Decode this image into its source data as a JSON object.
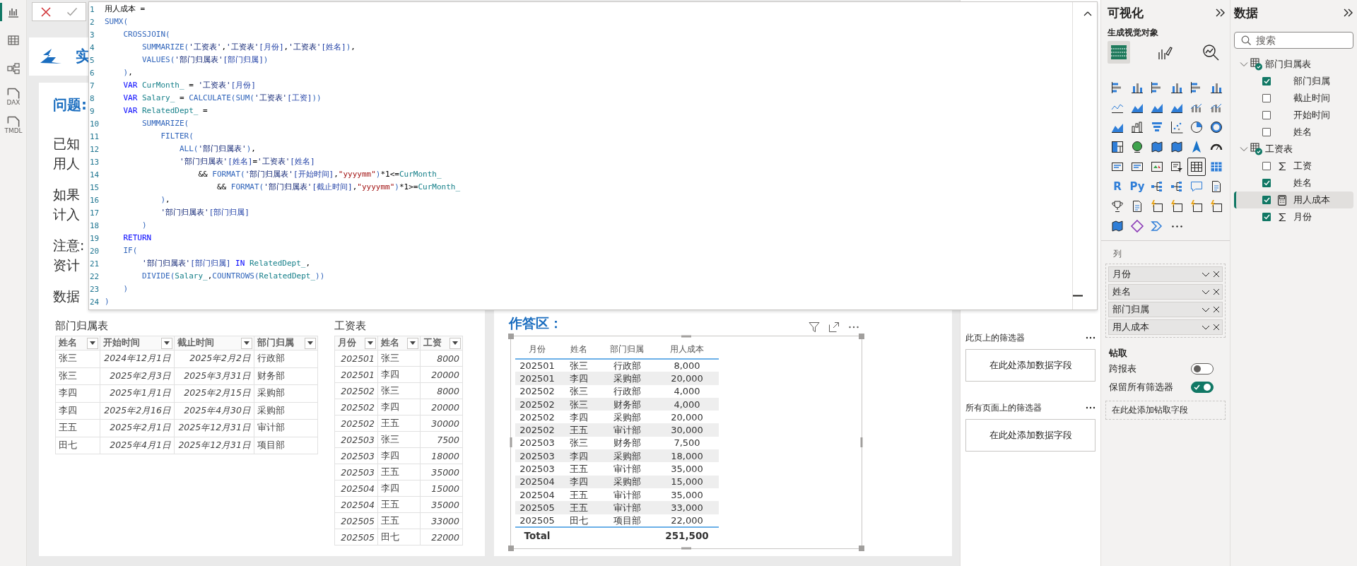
{
  "nav": [
    {
      "kind": "report",
      "selected": true
    },
    {
      "kind": "table",
      "selected": false
    },
    {
      "kind": "model",
      "selected": false
    },
    {
      "kind": "doc",
      "label": "DAX",
      "selected": false
    },
    {
      "kind": "doc",
      "label": "TMDL",
      "selected": false
    }
  ],
  "editor": {
    "lines": [
      {
        "number": "1",
        "tokens": [
          {
            "kind": "plain",
            "text": "用人成本 ="
          }
        ]
      },
      {
        "number": "2",
        "tokens": [
          {
            "kind": "fn",
            "text": "SUMX("
          }
        ]
      },
      {
        "number": "3",
        "tokens": [
          {
            "kind": "fn",
            "text": "    CROSSJOIN("
          }
        ]
      },
      {
        "number": "4",
        "tokens": [
          {
            "kind": "fn",
            "text": "        SUMMARIZE("
          },
          {
            "kind": "tbl",
            "text": "'工资表'"
          },
          {
            "kind": "plain",
            "text": ","
          },
          {
            "kind": "tbl",
            "text": "'工资表'"
          },
          {
            "kind": "col",
            "text": "[月份]"
          },
          {
            "kind": "plain",
            "text": ","
          },
          {
            "kind": "tbl",
            "text": "'工资表'"
          },
          {
            "kind": "col",
            "text": "[姓名]"
          },
          {
            "kind": "fn",
            "text": ")"
          },
          {
            "kind": "plain",
            "text": ","
          }
        ]
      },
      {
        "number": "5",
        "tokens": [
          {
            "kind": "fn",
            "text": "        VALUES("
          },
          {
            "kind": "tbl",
            "text": "'部门归属表'"
          },
          {
            "kind": "col",
            "text": "[部门归属]"
          },
          {
            "kind": "fn",
            "text": ")"
          }
        ]
      },
      {
        "number": "6",
        "tokens": [
          {
            "kind": "fn",
            "text": "    )"
          },
          {
            "kind": "plain",
            "text": ","
          }
        ]
      },
      {
        "number": "7",
        "tokens": [
          {
            "kind": "kw",
            "text": "    VAR"
          },
          {
            "kind": "var",
            "text": " CurMonth_"
          },
          {
            "kind": "plain",
            "text": " = "
          },
          {
            "kind": "tbl",
            "text": "'工资表'"
          },
          {
            "kind": "col",
            "text": "[月份]"
          }
        ]
      },
      {
        "number": "8",
        "tokens": [
          {
            "kind": "kw",
            "text": "    VAR"
          },
          {
            "kind": "var",
            "text": " Salary_"
          },
          {
            "kind": "plain",
            "text": " = "
          },
          {
            "kind": "fn",
            "text": "CALCULATE(SUM("
          },
          {
            "kind": "tbl",
            "text": "'工资表'"
          },
          {
            "kind": "col",
            "text": "[工资]"
          },
          {
            "kind": "fn",
            "text": "))"
          }
        ]
      },
      {
        "number": "9",
        "tokens": [
          {
            "kind": "kw",
            "text": "    VAR"
          },
          {
            "kind": "var",
            "text": " RelatedDept_"
          },
          {
            "kind": "plain",
            "text": " ="
          }
        ]
      },
      {
        "number": "10",
        "tokens": [
          {
            "kind": "fn",
            "text": "        SUMMARIZE("
          }
        ]
      },
      {
        "number": "11",
        "tokens": [
          {
            "kind": "fn",
            "text": "            FILTER("
          }
        ]
      },
      {
        "number": "12",
        "tokens": [
          {
            "kind": "fn",
            "text": "                ALL("
          },
          {
            "kind": "tbl",
            "text": "'部门归属表'"
          },
          {
            "kind": "fn",
            "text": ")"
          },
          {
            "kind": "plain",
            "text": ","
          }
        ]
      },
      {
        "number": "13",
        "tokens": [
          {
            "kind": "tbl",
            "text": "                '部门归属表'"
          },
          {
            "kind": "col",
            "text": "[姓名]"
          },
          {
            "kind": "plain",
            "text": "="
          },
          {
            "kind": "tbl",
            "text": "'工资表'"
          },
          {
            "kind": "col",
            "text": "[姓名]"
          }
        ]
      },
      {
        "number": "14",
        "tokens": [
          {
            "kind": "plain",
            "text": "                    && "
          },
          {
            "kind": "fn",
            "text": "FORMAT("
          },
          {
            "kind": "tbl",
            "text": "'部门归属表'"
          },
          {
            "kind": "col",
            "text": "[开始时间]"
          },
          {
            "kind": "plain",
            "text": ","
          },
          {
            "kind": "str",
            "text": "\"yyyymm\""
          },
          {
            "kind": "fn",
            "text": ")"
          },
          {
            "kind": "plain",
            "text": "*1<="
          },
          {
            "kind": "var",
            "text": "CurMonth_"
          }
        ]
      },
      {
        "number": "15",
        "tokens": [
          {
            "kind": "plain",
            "text": "                        && "
          },
          {
            "kind": "fn",
            "text": "FORMAT("
          },
          {
            "kind": "tbl",
            "text": "'部门归属表'"
          },
          {
            "kind": "col",
            "text": "[截止时间]"
          },
          {
            "kind": "plain",
            "text": ","
          },
          {
            "kind": "str",
            "text": "\"yyyymm\""
          },
          {
            "kind": "fn",
            "text": ")"
          },
          {
            "kind": "plain",
            "text": "*1>="
          },
          {
            "kind": "var",
            "text": "CurMonth_"
          }
        ]
      },
      {
        "number": "16",
        "tokens": [
          {
            "kind": "fn",
            "text": "            )"
          },
          {
            "kind": "plain",
            "text": ","
          }
        ]
      },
      {
        "number": "17",
        "tokens": [
          {
            "kind": "tbl",
            "text": "            '部门归属表'"
          },
          {
            "kind": "col",
            "text": "[部门归属]"
          }
        ]
      },
      {
        "number": "18",
        "tokens": [
          {
            "kind": "fn",
            "text": "        )"
          }
        ]
      },
      {
        "number": "19",
        "tokens": [
          {
            "kind": "kw",
            "text": "    RETURN"
          }
        ]
      },
      {
        "number": "20",
        "tokens": [
          {
            "kind": "fn",
            "text": "    IF("
          }
        ]
      },
      {
        "number": "21",
        "tokens": [
          {
            "kind": "tbl",
            "text": "        '部门归属表'"
          },
          {
            "kind": "col",
            "text": "[部门归属]"
          },
          {
            "kind": "kw",
            "text": " IN"
          },
          {
            "kind": "var",
            "text": " RelatedDept_"
          },
          {
            "kind": "plain",
            "text": ","
          }
        ]
      },
      {
        "number": "22",
        "tokens": [
          {
            "kind": "fn",
            "text": "        DIVIDE("
          },
          {
            "kind": "var",
            "text": "Salary_"
          },
          {
            "kind": "plain",
            "text": ","
          },
          {
            "kind": "fn",
            "text": "COUNTROWS("
          },
          {
            "kind": "var",
            "text": "RelatedDept_"
          },
          {
            "kind": "fn",
            "text": "))"
          }
        ]
      },
      {
        "number": "23",
        "tokens": [
          {
            "kind": "fn",
            "text": "    )"
          }
        ]
      },
      {
        "number": "24",
        "tokens": [
          {
            "kind": "fn",
            "text": ")"
          }
        ]
      }
    ]
  },
  "canvas": {
    "header_text": "实",
    "question_title": "问题:",
    "paragraphs": [
      [
        "已知",
        "用人"
      ],
      [
        "如果",
        "计入"
      ],
      [
        "注意:",
        "资计"
      ],
      [
        "数据"
      ]
    ],
    "tables": [
      {
        "title": "部门归属表",
        "columns": [
          {
            "name": "姓名",
            "kind": "text"
          },
          {
            "name": "开始时间",
            "kind": "date"
          },
          {
            "name": "截止时间",
            "kind": "date"
          },
          {
            "name": "部门归属",
            "kind": "text"
          }
        ],
        "rows": [
          [
            "张三",
            "2024年12月1日",
            "2025年2月2日",
            "行政部"
          ],
          [
            "张三",
            "2025年2月3日",
            "2025年3月31日",
            "财务部"
          ],
          [
            "李四",
            "2025年1月1日",
            "2025年2月15日",
            "采购部"
          ],
          [
            "李四",
            "2025年2月16日",
            "2025年4月30日",
            "采购部"
          ],
          [
            "王五",
            "2025年2月1日",
            "2025年12月31日",
            "审计部"
          ],
          [
            "田七",
            "2025年4月1日",
            "2025年12月31日",
            "项目部"
          ]
        ]
      },
      {
        "title": "工资表",
        "columns": [
          {
            "name": "月份",
            "kind": "number"
          },
          {
            "name": "姓名",
            "kind": "text"
          },
          {
            "name": "工资",
            "kind": "number"
          }
        ],
        "rows": [
          [
            "202501",
            "张三",
            "8000"
          ],
          [
            "202501",
            "李四",
            "20000"
          ],
          [
            "202502",
            "张三",
            "8000"
          ],
          [
            "202502",
            "李四",
            "20000"
          ],
          [
            "202502",
            "王五",
            "30000"
          ],
          [
            "202503",
            "张三",
            "7500"
          ],
          [
            "202503",
            "李四",
            "18000"
          ],
          [
            "202503",
            "王五",
            "35000"
          ],
          [
            "202504",
            "李四",
            "15000"
          ],
          [
            "202504",
            "王五",
            "35000"
          ],
          [
            "202505",
            "王五",
            "33000"
          ],
          [
            "202505",
            "田七",
            "22000"
          ]
        ]
      }
    ],
    "answer": {
      "title": "作答区：",
      "columns": [
        "月份",
        "姓名",
        "部门归属",
        "用人成本"
      ],
      "rows": [
        [
          "202501",
          "张三",
          "行政部",
          "8,000"
        ],
        [
          "202501",
          "李四",
          "采购部",
          "20,000"
        ],
        [
          "202502",
          "张三",
          "行政部",
          "4,000"
        ],
        [
          "202502",
          "张三",
          "财务部",
          "4,000"
        ],
        [
          "202502",
          "李四",
          "采购部",
          "20,000"
        ],
        [
          "202502",
          "王五",
          "审计部",
          "30,000"
        ],
        [
          "202503",
          "张三",
          "财务部",
          "7,500"
        ],
        [
          "202503",
          "李四",
          "采购部",
          "18,000"
        ],
        [
          "202503",
          "王五",
          "审计部",
          "35,000"
        ],
        [
          "202504",
          "李四",
          "采购部",
          "15,000"
        ],
        [
          "202504",
          "王五",
          "审计部",
          "35,000"
        ],
        [
          "202505",
          "王五",
          "审计部",
          "33,000"
        ],
        [
          "202505",
          "田七",
          "项目部",
          "22,000"
        ]
      ],
      "total": {
        "label": "Total",
        "value": "251,500"
      }
    }
  },
  "filters": {
    "sections": [
      {
        "title": "此页上的筛选器",
        "drop_text": "在此处添加数据字段"
      },
      {
        "title": "所有页面上的筛选器",
        "drop_text": "在此处添加数据字段"
      }
    ]
  },
  "visualizations": {
    "title": "可视化",
    "subtitle": "生成视觉对象",
    "build_tabs": [
      {
        "kind": "fields",
        "selected": true
      },
      {
        "kind": "format",
        "selected": false
      },
      {
        "kind": "analytics",
        "selected": false
      }
    ],
    "gallery": [
      {
        "kind": "hbar",
        "selected": false
      },
      {
        "kind": "vbar",
        "selected": false
      },
      {
        "kind": "hbar",
        "selected": false
      },
      {
        "kind": "vbar",
        "selected": false
      },
      {
        "kind": "hbar",
        "selected": false
      },
      {
        "kind": "vbar",
        "selected": false
      },
      {
        "kind": "line",
        "selected": false
      },
      {
        "kind": "area",
        "selected": false
      },
      {
        "kind": "area",
        "selected": false
      },
      {
        "kind": "area",
        "selected": false
      },
      {
        "kind": "combo",
        "selected": false
      },
      {
        "kind": "combo",
        "selected": false
      },
      {
        "kind": "area",
        "selected": false
      },
      {
        "kind": "waterfall",
        "selected": false
      },
      {
        "kind": "funnel",
        "selected": false
      },
      {
        "kind": "scatter",
        "selected": false
      },
      {
        "kind": "pie",
        "selected": false
      },
      {
        "kind": "donut",
        "selected": false
      },
      {
        "kind": "treemap",
        "selected": false
      },
      {
        "kind": "globe",
        "selected": false
      },
      {
        "kind": "map",
        "selected": false
      },
      {
        "kind": "map",
        "selected": false
      },
      {
        "kind": "arrow",
        "selected": false
      },
      {
        "kind": "gauge",
        "selected": false
      },
      {
        "kind": "card",
        "selected": false
      },
      {
        "kind": "card",
        "selected": false
      },
      {
        "kind": "kpi",
        "selected": false
      },
      {
        "kind": "slicer",
        "selected": false
      },
      {
        "kind": "table",
        "selected": true
      },
      {
        "kind": "matrix",
        "selected": false
      },
      {
        "kind": "letters",
        "label": "R",
        "selected": false
      },
      {
        "kind": "letters",
        "label": "Py",
        "selected": false
      },
      {
        "kind": "tree",
        "selected": false
      },
      {
        "kind": "tree",
        "selected": false
      },
      {
        "kind": "bubble",
        "selected": false
      },
      {
        "kind": "doc",
        "selected": false
      },
      {
        "kind": "trophy",
        "selected": false
      },
      {
        "kind": "doc",
        "selected": false
      },
      {
        "kind": "bolt",
        "selected": false
      },
      {
        "kind": "bolt",
        "selected": false
      },
      {
        "kind": "bolt",
        "selected": false
      },
      {
        "kind": "bolt",
        "selected": false
      },
      {
        "kind": "map",
        "selected": false
      },
      {
        "kind": "diamond",
        "selected": false
      },
      {
        "kind": "chevron",
        "selected": false
      },
      {
        "kind": "more",
        "selected": false
      }
    ],
    "well_title": "列",
    "wells": [
      "月份",
      "姓名",
      "部门归属",
      "用人成本"
    ],
    "drill_title": "钻取",
    "toggles": [
      {
        "label": "跨报表",
        "on": false
      },
      {
        "label": "保留所有筛选器",
        "on": true
      }
    ],
    "drill_drop": "在此处添加钻取字段"
  },
  "data": {
    "title": "数据",
    "search": {
      "placeholder": "搜索"
    },
    "tables": [
      {
        "name": "部门归属表",
        "expanded": true,
        "children": [
          {
            "name": "部门归属",
            "kind": "column",
            "checked": true,
            "selected": false
          },
          {
            "name": "截止时间",
            "kind": "column",
            "checked": false,
            "selected": false
          },
          {
            "name": "开始时间",
            "kind": "column",
            "checked": false,
            "selected": false
          },
          {
            "name": "姓名",
            "kind": "column",
            "checked": false,
            "selected": false
          }
        ]
      },
      {
        "name": "工资表",
        "expanded": true,
        "children": [
          {
            "name": "工资",
            "kind": "sum",
            "checked": false,
            "selected": false
          },
          {
            "name": "姓名",
            "kind": "column",
            "checked": true,
            "selected": false
          },
          {
            "name": "用人成本",
            "kind": "measure",
            "checked": true,
            "selected": true
          },
          {
            "name": "月份",
            "kind": "sum",
            "checked": true,
            "selected": false
          }
        ]
      }
    ]
  }
}
